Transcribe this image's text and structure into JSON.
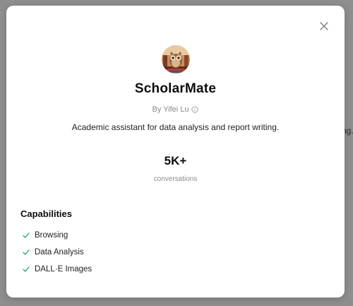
{
  "background": {
    "partial_text": "ng."
  },
  "modal": {
    "close_icon": "close-icon",
    "gpt_name": "ScholarMate",
    "author": "By Yifei Lu",
    "author_info_icon": "info-icon",
    "description": "Academic assistant for data analysis and report writing.",
    "stats": {
      "value": "5K+",
      "label": "conversations"
    },
    "capabilities": {
      "heading": "Capabilities",
      "items": [
        {
          "label": "Browsing",
          "icon": "check-icon"
        },
        {
          "label": "Data Analysis",
          "icon": "check-icon"
        },
        {
          "label": "DALL·E Images",
          "icon": "check-icon"
        }
      ]
    }
  },
  "colors": {
    "backdrop": "#8e8e8e",
    "modal_bg": "#ffffff",
    "check_green": "#10a37f",
    "muted_text": "#8a8a8a"
  }
}
